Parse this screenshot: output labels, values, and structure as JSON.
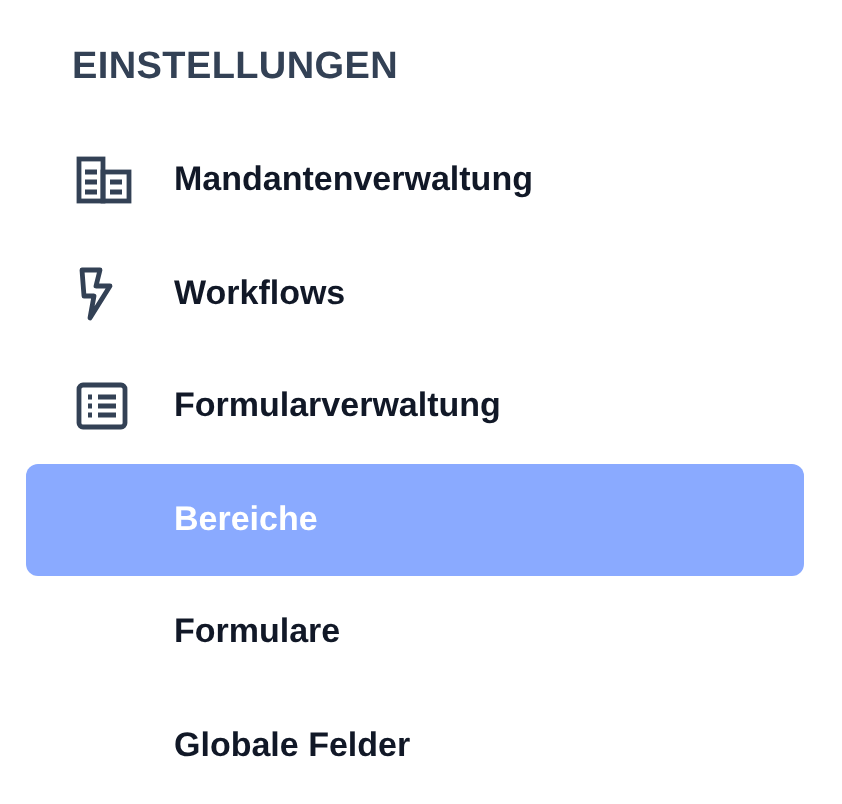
{
  "section": {
    "title": "EINSTELLUNGEN"
  },
  "items": [
    {
      "label": "Mandantenverwaltung",
      "selected": false
    },
    {
      "label": "Workflows",
      "selected": false
    },
    {
      "label": "Formularverwaltung",
      "selected": false,
      "children": [
        {
          "label": "Bereiche",
          "selected": true
        },
        {
          "label": "Formulare",
          "selected": false
        },
        {
          "label": "Globale Felder",
          "selected": false
        }
      ]
    }
  ]
}
